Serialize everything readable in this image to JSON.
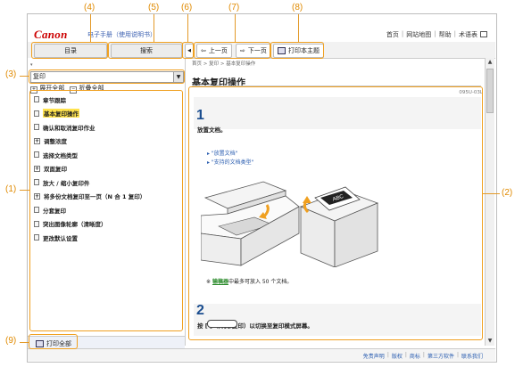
{
  "callouts": {
    "c1": "(1)",
    "c2": "(2)",
    "c3": "(3)",
    "c4": "(4)",
    "c5": "(5)",
    "c6": "(6)",
    "c7": "(7)",
    "c8": "(8)",
    "c9": "(9)"
  },
  "header": {
    "logo": "Canon",
    "app_title": "电子手册（使用说明书）",
    "links": [
      "首页",
      "网站地图",
      "帮助",
      "术语表"
    ]
  },
  "tabs": {
    "contents": "目录",
    "search": "搜索"
  },
  "nav": {
    "prev": "上一页",
    "next": "下一页",
    "print_topic": "打印本主题"
  },
  "sidebar": {
    "select_value": "复印",
    "expand_all": "展开全部",
    "collapse_all": "折叠全部",
    "items": [
      {
        "label": "章节跟踪",
        "type": "page",
        "active": false
      },
      {
        "label": "基本复印操作",
        "type": "page",
        "active": true
      },
      {
        "label": "确认和取消复印作业",
        "type": "page",
        "active": false
      },
      {
        "label": "调整浓度",
        "type": "folder",
        "active": false
      },
      {
        "label": "选择文档类型",
        "type": "page",
        "active": false
      },
      {
        "label": "双面复印",
        "type": "folder",
        "active": false
      },
      {
        "label": "放大 / 缩小复印件",
        "type": "page",
        "active": false
      },
      {
        "label": "将多份文档复印至一页（N 合 1 复印）",
        "type": "folder",
        "active": false
      },
      {
        "label": "分套复印",
        "type": "page",
        "active": false
      },
      {
        "label": "突出图像轮廓（清晰度）",
        "type": "page",
        "active": false
      },
      {
        "label": "更改默认设置",
        "type": "page",
        "active": false
      }
    ],
    "print_all": "打印全部"
  },
  "content": {
    "breadcrumb": "首页 > 复印 > 基本复印操作",
    "title": "基本复印操作",
    "doc_id": "095U-03L",
    "step1_num": "1",
    "step1_text": "放置文档。",
    "link1": "\"放置文档\"",
    "link2": "\"支持的文档类型\"",
    "note_prefix": "※ ",
    "note_link": "输稿器",
    "note_rest": "中最多可放入 50 个文档。",
    "step2_num": "2",
    "step2_text": "按 [          ]（传真/复印）以切换至复印模式屏幕。",
    "doc_label": "ABC"
  },
  "footer": {
    "links": [
      "免责声明",
      "版权",
      "商标",
      "第三方软件",
      "联系我们"
    ]
  },
  "colors": {
    "callout": "#e08a00",
    "box": "#f0a020",
    "accent": "#1a4d8f",
    "logo": "#cc0000"
  }
}
